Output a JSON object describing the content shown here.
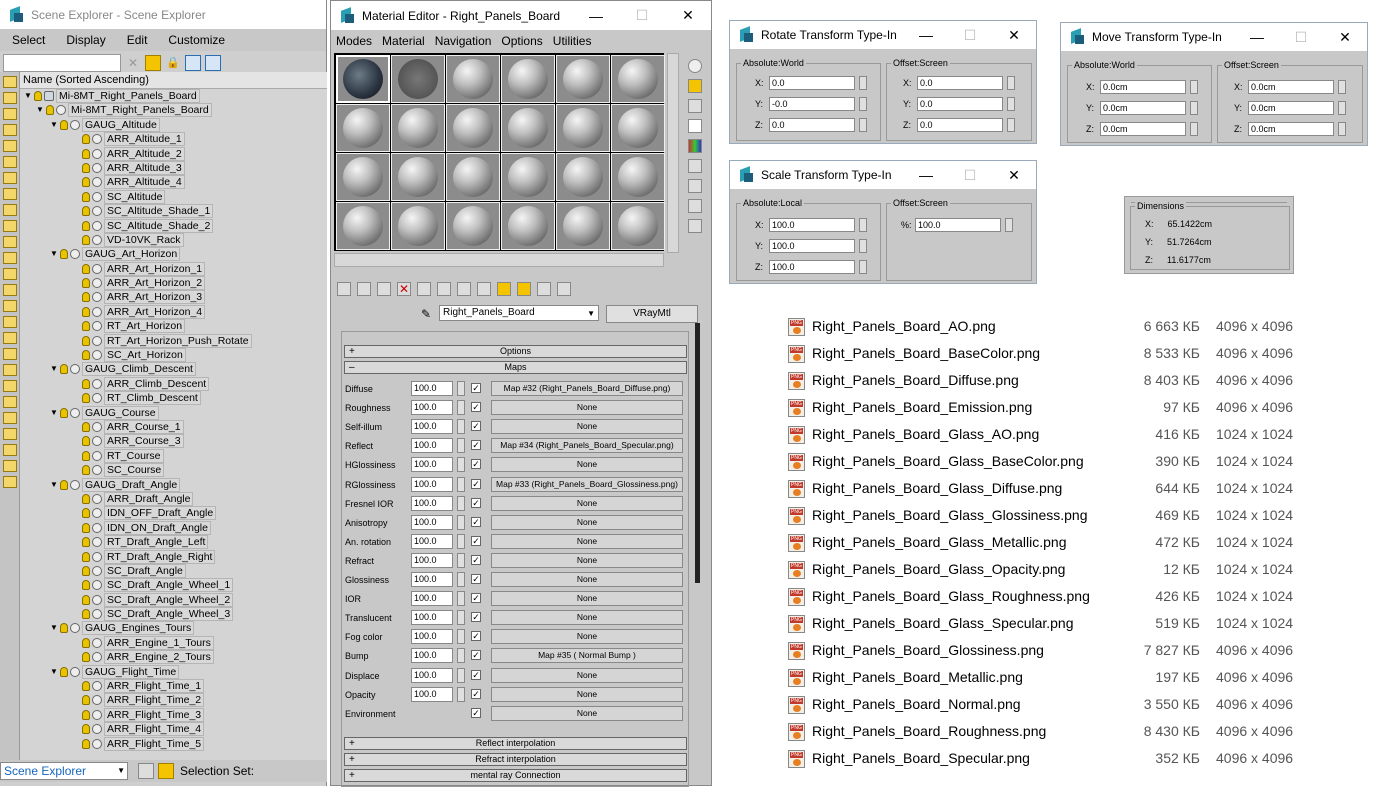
{
  "scene_explorer": {
    "title": "Scene Explorer - Scene Explorer",
    "menu": [
      "Select",
      "Display",
      "Edit",
      "Customize"
    ],
    "column_header": "Name (Sorted Ascending)",
    "tree": [
      {
        "label": "Mi-8MT_Right_Panels_Board",
        "level": 0,
        "type": "root"
      },
      {
        "label": "Mi-8MT_Right_Panels_Board",
        "level": 1,
        "type": "group"
      },
      {
        "label": "GAUG_Altitude",
        "level": 2,
        "type": "group"
      },
      {
        "label": "ARR_Altitude_1",
        "level": 3,
        "type": "item"
      },
      {
        "label": "ARR_Altitude_2",
        "level": 3,
        "type": "item"
      },
      {
        "label": "ARR_Altitude_3",
        "level": 3,
        "type": "item"
      },
      {
        "label": "ARR_Altitude_4",
        "level": 3,
        "type": "item"
      },
      {
        "label": "SC_Altitude",
        "level": 3,
        "type": "item"
      },
      {
        "label": "SC_Altitude_Shade_1",
        "level": 3,
        "type": "item"
      },
      {
        "label": "SC_Altitude_Shade_2",
        "level": 3,
        "type": "item"
      },
      {
        "label": "VD-10VK_Rack",
        "level": 3,
        "type": "item"
      },
      {
        "label": "GAUG_Art_Horizon",
        "level": 2,
        "type": "group"
      },
      {
        "label": "ARR_Art_Horizon_1",
        "level": 3,
        "type": "item"
      },
      {
        "label": "ARR_Art_Horizon_2",
        "level": 3,
        "type": "item"
      },
      {
        "label": "ARR_Art_Horizon_3",
        "level": 3,
        "type": "item"
      },
      {
        "label": "ARR_Art_Horizon_4",
        "level": 3,
        "type": "item"
      },
      {
        "label": "RT_Art_Horizon",
        "level": 3,
        "type": "item"
      },
      {
        "label": "RT_Art_Horizon_Push_Rotate",
        "level": 3,
        "type": "item"
      },
      {
        "label": "SC_Art_Horizon",
        "level": 3,
        "type": "item"
      },
      {
        "label": "GAUG_Climb_Descent",
        "level": 2,
        "type": "group"
      },
      {
        "label": "ARR_Climb_Descent",
        "level": 3,
        "type": "item"
      },
      {
        "label": "RT_Climb_Descent",
        "level": 3,
        "type": "item"
      },
      {
        "label": "GAUG_Course",
        "level": 2,
        "type": "group"
      },
      {
        "label": "ARR_Course_1",
        "level": 3,
        "type": "item"
      },
      {
        "label": "ARR_Course_3",
        "level": 3,
        "type": "item"
      },
      {
        "label": "RT_Course",
        "level": 3,
        "type": "item"
      },
      {
        "label": "SC_Course",
        "level": 3,
        "type": "item"
      },
      {
        "label": "GAUG_Draft_Angle",
        "level": 2,
        "type": "group"
      },
      {
        "label": "ARR_Draft_Angle",
        "level": 3,
        "type": "item"
      },
      {
        "label": "IDN_OFF_Draft_Angle",
        "level": 3,
        "type": "item"
      },
      {
        "label": "IDN_ON_Draft_Angle",
        "level": 3,
        "type": "item"
      },
      {
        "label": "RT_Draft_Angle_Left",
        "level": 3,
        "type": "item"
      },
      {
        "label": "RT_Draft_Angle_Right",
        "level": 3,
        "type": "item"
      },
      {
        "label": "SC_Draft_Angle",
        "level": 3,
        "type": "item"
      },
      {
        "label": "SC_Draft_Angle_Wheel_1",
        "level": 3,
        "type": "item"
      },
      {
        "label": "SC_Draft_Angle_Wheel_2",
        "level": 3,
        "type": "item"
      },
      {
        "label": "SC_Draft_Angle_Wheel_3",
        "level": 3,
        "type": "item"
      },
      {
        "label": "GAUG_Engines_Tours",
        "level": 2,
        "type": "group"
      },
      {
        "label": "ARR_Engine_1_Tours",
        "level": 3,
        "type": "item"
      },
      {
        "label": "ARR_Engine_2_Tours",
        "level": 3,
        "type": "item"
      },
      {
        "label": "GAUG_Flight_Time",
        "level": 2,
        "type": "group"
      },
      {
        "label": "ARR_Flight_Time_1",
        "level": 3,
        "type": "item"
      },
      {
        "label": "ARR_Flight_Time_2",
        "level": 3,
        "type": "item"
      },
      {
        "label": "ARR_Flight_Time_3",
        "level": 3,
        "type": "item"
      },
      {
        "label": "ARR_Flight_Time_4",
        "level": 3,
        "type": "item"
      },
      {
        "label": "ARR_Flight_Time_5",
        "level": 3,
        "type": "item"
      }
    ],
    "status_combo": "Scene Explorer",
    "selection_set_label": "Selection Set:"
  },
  "material_editor": {
    "title": "Material Editor - Right_Panels_Board",
    "menu": [
      "Modes",
      "Material",
      "Navigation",
      "Options",
      "Utilities"
    ],
    "material_name": "Right_Panels_Board",
    "material_type": "VRayMtl",
    "rollouts_top": [
      {
        "sign": "+",
        "label": "Options"
      },
      {
        "sign": "–",
        "label": "Maps"
      }
    ],
    "maps": [
      {
        "label": "Diffuse",
        "value": "100.0",
        "checked": true,
        "map": "Map #32 (Right_Panels_Board_Diffuse.png)"
      },
      {
        "label": "Roughness",
        "value": "100.0",
        "checked": true,
        "map": "None"
      },
      {
        "label": "Self-illum",
        "value": "100.0",
        "checked": true,
        "map": "None"
      },
      {
        "label": "Reflect",
        "value": "100.0",
        "checked": true,
        "map": "Map #34 (Right_Panels_Board_Specular.png)"
      },
      {
        "label": "HGlossiness",
        "value": "100.0",
        "checked": true,
        "map": "None"
      },
      {
        "label": "RGlossiness",
        "value": "100.0",
        "checked": true,
        "map": "Map #33 (Right_Panels_Board_Glossiness.png)"
      },
      {
        "label": "Fresnel IOR",
        "value": "100.0",
        "checked": true,
        "map": "None"
      },
      {
        "label": "Anisotropy",
        "value": "100.0",
        "checked": true,
        "map": "None"
      },
      {
        "label": "An. rotation",
        "value": "100.0",
        "checked": true,
        "map": "None"
      },
      {
        "label": "Refract",
        "value": "100.0",
        "checked": true,
        "map": "None"
      },
      {
        "label": "Glossiness",
        "value": "100.0",
        "checked": true,
        "map": "None"
      },
      {
        "label": "IOR",
        "value": "100.0",
        "checked": true,
        "map": "None"
      },
      {
        "label": "Translucent",
        "value": "100.0",
        "checked": true,
        "map": "None"
      },
      {
        "label": "Fog color",
        "value": "100.0",
        "checked": true,
        "map": "None"
      },
      {
        "label": "Bump",
        "value": "100.0",
        "checked": true,
        "map": "Map #35  ( Normal Bump )"
      },
      {
        "label": "Displace",
        "value": "100.0",
        "checked": true,
        "map": "None"
      },
      {
        "label": "Opacity",
        "value": "100.0",
        "checked": true,
        "map": "None"
      },
      {
        "label": "Environment",
        "value": "",
        "checked": true,
        "map": "None"
      }
    ],
    "rollouts_bottom": [
      {
        "sign": "+",
        "label": "Reflect interpolation"
      },
      {
        "sign": "+",
        "label": "Refract interpolation"
      },
      {
        "sign": "+",
        "label": "mental ray Connection"
      }
    ]
  },
  "rotate_dialog": {
    "title": "Rotate Transform Type-In",
    "left_group": "Absolute:World",
    "right_group": "Offset:Screen",
    "left": [
      {
        "axis": "X:",
        "value": "0.0"
      },
      {
        "axis": "Y:",
        "value": "-0.0"
      },
      {
        "axis": "Z:",
        "value": "0.0"
      }
    ],
    "right": [
      {
        "axis": "X:",
        "value": "0.0"
      },
      {
        "axis": "Y:",
        "value": "0.0"
      },
      {
        "axis": "Z:",
        "value": "0.0"
      }
    ]
  },
  "move_dialog": {
    "title": "Move Transform Type-In",
    "left_group": "Absolute:World",
    "right_group": "Offset:Screen",
    "left": [
      {
        "axis": "X:",
        "value": "0.0cm"
      },
      {
        "axis": "Y:",
        "value": "0.0cm"
      },
      {
        "axis": "Z:",
        "value": "0.0cm"
      }
    ],
    "right": [
      {
        "axis": "X:",
        "value": "0.0cm"
      },
      {
        "axis": "Y:",
        "value": "0.0cm"
      },
      {
        "axis": "Z:",
        "value": "0.0cm"
      }
    ]
  },
  "scale_dialog": {
    "title": "Scale Transform Type-In",
    "left_group": "Absolute:Local",
    "right_group": "Offset:Screen",
    "left": [
      {
        "axis": "X:",
        "value": "100.0"
      },
      {
        "axis": "Y:",
        "value": "100.0"
      },
      {
        "axis": "Z:",
        "value": "100.0"
      }
    ],
    "right": [
      {
        "axis": "%:",
        "value": "100.0"
      }
    ]
  },
  "dimensions": {
    "title": "Dimensions",
    "rows": [
      {
        "axis": "X:",
        "value": "65.1422cm"
      },
      {
        "axis": "Y:",
        "value": "51.7264cm"
      },
      {
        "axis": "Z:",
        "value": "11.6177cm"
      }
    ]
  },
  "files": [
    {
      "name": "Right_Panels_Board_AO.png",
      "size": "6 663 КБ",
      "dims": "4096 x 4096"
    },
    {
      "name": "Right_Panels_Board_BaseColor.png",
      "size": "8 533 КБ",
      "dims": "4096 x 4096"
    },
    {
      "name": "Right_Panels_Board_Diffuse.png",
      "size": "8 403 КБ",
      "dims": "4096 x 4096"
    },
    {
      "name": "Right_Panels_Board_Emission.png",
      "size": "97 КБ",
      "dims": "4096 x 4096"
    },
    {
      "name": "Right_Panels_Board_Glass_AO.png",
      "size": "416 КБ",
      "dims": "1024 x 1024"
    },
    {
      "name": "Right_Panels_Board_Glass_BaseColor.png",
      "size": "390 КБ",
      "dims": "1024 x 1024"
    },
    {
      "name": "Right_Panels_Board_Glass_Diffuse.png",
      "size": "644 КБ",
      "dims": "1024 x 1024"
    },
    {
      "name": "Right_Panels_Board_Glass_Glossiness.png",
      "size": "469 КБ",
      "dims": "1024 x 1024"
    },
    {
      "name": "Right_Panels_Board_Glass_Metallic.png",
      "size": "472 КБ",
      "dims": "1024 x 1024"
    },
    {
      "name": "Right_Panels_Board_Glass_Opacity.png",
      "size": "12 КБ",
      "dims": "1024 x 1024"
    },
    {
      "name": "Right_Panels_Board_Glass_Roughness.png",
      "size": "426 КБ",
      "dims": "1024 x 1024"
    },
    {
      "name": "Right_Panels_Board_Glass_Specular.png",
      "size": "519 КБ",
      "dims": "1024 x 1024"
    },
    {
      "name": "Right_Panels_Board_Glossiness.png",
      "size": "7 827 КБ",
      "dims": "4096 x 4096"
    },
    {
      "name": "Right_Panels_Board_Metallic.png",
      "size": "197 КБ",
      "dims": "4096 x 4096"
    },
    {
      "name": "Right_Panels_Board_Normal.png",
      "size": "3 550 КБ",
      "dims": "4096 x 4096"
    },
    {
      "name": "Right_Panels_Board_Roughness.png",
      "size": "8 430 КБ",
      "dims": "4096 x 4096"
    },
    {
      "name": "Right_Panels_Board_Specular.png",
      "size": "352 КБ",
      "dims": "4096 x 4096"
    }
  ]
}
